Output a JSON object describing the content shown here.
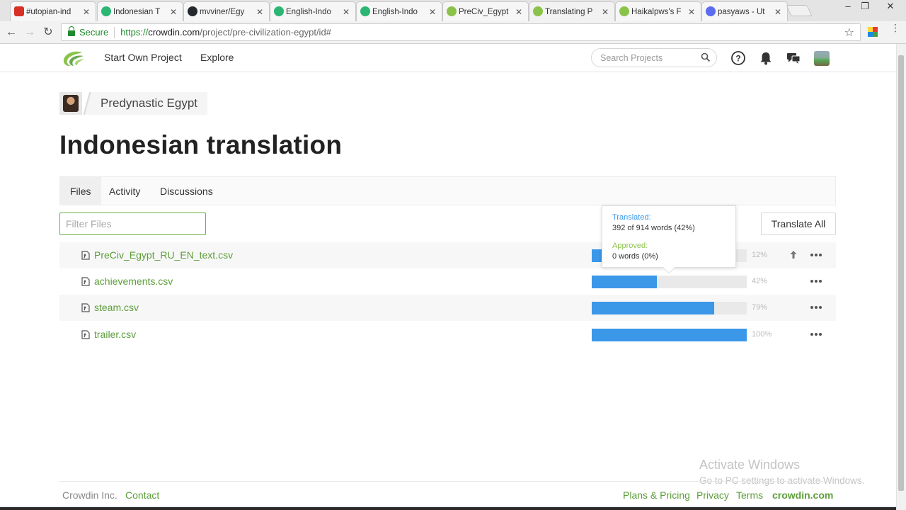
{
  "browser": {
    "tabs": [
      {
        "title": "#utopian-ind",
        "favicon": "#d93025"
      },
      {
        "title": "Indonesian T",
        "favicon": "#2bb673"
      },
      {
        "title": "mvviner/Egy",
        "favicon": "#24292e"
      },
      {
        "title": "English-Indo",
        "favicon": "#2bb673"
      },
      {
        "title": "English-Indo",
        "favicon": "#2bb673"
      },
      {
        "title": "PreCiv_Egypt",
        "favicon": "#8bc34a"
      },
      {
        "title": "Translating P",
        "favicon": "#8bc34a"
      },
      {
        "title": "Haikalpws's F",
        "favicon": "#8bc34a"
      },
      {
        "title": "pasyaws - Ut",
        "favicon": "#5b6cf0"
      }
    ],
    "secure_label": "Secure",
    "url_scheme": "https://",
    "url_domain": "crowdin.com",
    "url_path": "/project/pre-civilization-egypt/id#"
  },
  "header": {
    "nav": [
      "Start Own Project",
      "Explore"
    ],
    "search_placeholder": "Search Projects",
    "brand_color": "#8bc34a"
  },
  "breadcrumb": {
    "project": "Predynastic Egypt"
  },
  "page_title": "Indonesian translation",
  "tabs": [
    "Files",
    "Activity",
    "Discussions"
  ],
  "filter_placeholder": "Filter Files",
  "translate_all_label": "Translate All",
  "files": [
    {
      "name": "PreCiv_Egypt_RU_EN_text.csv",
      "progress": 12,
      "pct_label": "12%"
    },
    {
      "name": "achievements.csv",
      "progress": 42,
      "pct_label": "42%"
    },
    {
      "name": "steam.csv",
      "progress": 79,
      "pct_label": "79%"
    },
    {
      "name": "trailer.csv",
      "progress": 100,
      "pct_label": "100%"
    }
  ],
  "tooltip": {
    "translated_label": "Translated:",
    "translated_value": "392 of 914 words (42%)",
    "approved_label": "Approved:",
    "approved_value": "0 words (0%)"
  },
  "footer": {
    "company": "Crowdin Inc.",
    "contact": "Contact",
    "plans": "Plans & Pricing",
    "privacy": "Privacy",
    "terms": "Terms",
    "brand_link": "crowdin.com"
  },
  "watermark": {
    "line1": "Activate Windows",
    "line2": "Go to PC settings to activate Windows."
  }
}
